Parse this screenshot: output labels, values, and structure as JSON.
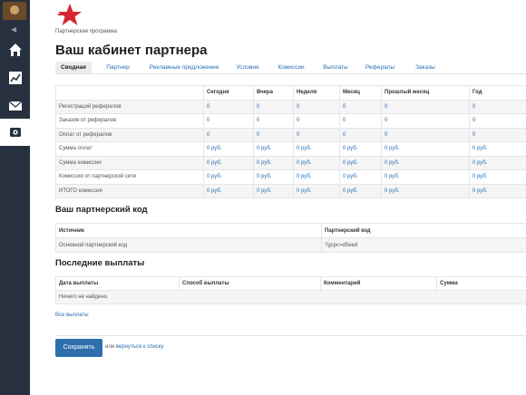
{
  "sidebar": {
    "items": [
      {
        "icon": "home-icon"
      },
      {
        "icon": "chart-icon"
      },
      {
        "icon": "mail-icon"
      },
      {
        "icon": "partner-icon",
        "active": true
      }
    ],
    "background": "#26303e"
  },
  "breadcrumb": "Партнерская программа",
  "page_title": "Ваш кабинет партнера",
  "tabs": [
    {
      "label": "Сводная",
      "active": true
    },
    {
      "label": "Партнер"
    },
    {
      "label": "Рекламные предложения"
    },
    {
      "label": "Условия"
    },
    {
      "label": "Комиссии"
    },
    {
      "label": "Выплаты"
    },
    {
      "label": "Рефералы"
    },
    {
      "label": "Заказы"
    }
  ],
  "stats": {
    "headers": [
      "",
      "Сегодня",
      "Вчера",
      "Неделя",
      "Месяц",
      "Прошлый месяц",
      "Год"
    ],
    "rows": [
      {
        "label": "Регистраций рефералов",
        "values": [
          "0",
          "0",
          "0",
          "0",
          "0",
          "0"
        ]
      },
      {
        "label": "Заказов от рефералов",
        "values": [
          "0",
          "0",
          "0",
          "0",
          "0",
          "0"
        ]
      },
      {
        "label": "Оплат от рефералов",
        "values": [
          "0",
          "0",
          "0",
          "0",
          "0",
          "0"
        ]
      },
      {
        "label": "Сумма оплат",
        "values": [
          "0 руб.",
          "0 руб.",
          "0 руб.",
          "0 руб.",
          "0 руб.",
          "0 руб."
        ]
      },
      {
        "label": "Сумма комиссии",
        "values": [
          "0 руб.",
          "0 руб.",
          "0 руб.",
          "0 руб.",
          "0 руб.",
          "0 руб."
        ]
      },
      {
        "label": "Комиссия от партнерской сети",
        "values": [
          "0 руб.",
          "0 руб.",
          "0 руб.",
          "0 руб.",
          "0 руб.",
          "0 руб."
        ]
      },
      {
        "label": "ИТОГО комиссия",
        "values": [
          "0 руб.",
          "0 руб.",
          "0 руб.",
          "0 руб.",
          "0 руб.",
          "0 руб."
        ]
      }
    ]
  },
  "partner_code": {
    "title": "Ваш партнерский код",
    "headers": [
      "Источник",
      "Партнерский код"
    ],
    "rows": [
      [
        "Основной партнерский код",
        "?gcpc=d5eed"
      ]
    ]
  },
  "payouts": {
    "title": "Последние выплаты",
    "headers": [
      "Дата выплаты",
      "Способ выплаты",
      "Комментарий",
      "Сумма"
    ],
    "empty": "Ничего не найдено.",
    "all_link": "Все выплаты"
  },
  "footer": {
    "save_label": "Сохранить",
    "or_text": "или",
    "back_link": "вернуться к списку"
  },
  "colors": {
    "accent": "#2f6fae",
    "link": "#2a6fb3",
    "logo": "#d6262f"
  }
}
